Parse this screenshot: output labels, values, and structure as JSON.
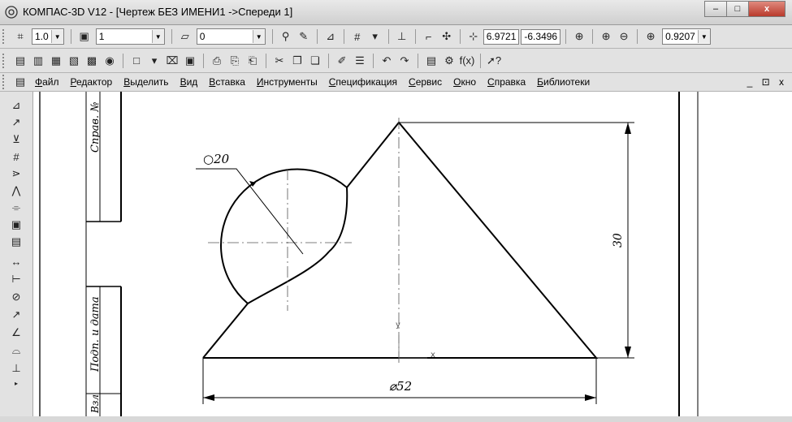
{
  "window": {
    "title": "КОМПАС-3D V12 - [Чертеж БЕЗ ИМЕНИ1 ->Спереди 1]",
    "minimize_glyph": "–",
    "maximize_glyph": "□",
    "close_glyph": "x"
  },
  "toolbar1": {
    "step_value": "1.0",
    "layer_value": "1",
    "style_value": "0",
    "coord_x": "6.9721",
    "coord_y": "-6.3496",
    "zoom_value": "0.9207"
  },
  "toolbar2": {
    "fx_label": "f(x)",
    "help_label": "?"
  },
  "menu": {
    "items": [
      "Файл",
      "Редактор",
      "Выделить",
      "Вид",
      "Вставка",
      "Инструменты",
      "Спецификация",
      "Сервис",
      "Окно",
      "Справка",
      "Библиотеки"
    ],
    "mdi_controls": "_ ⊡ x"
  },
  "drawing": {
    "stamp_top": "Справ. №",
    "stamp_bottom": "Подп. и дата",
    "stamp_cut": "Взл",
    "dim_radius": "○20",
    "dim_height": "30",
    "dim_diameter": "⌀52",
    "axis_y": "y",
    "axis_x": "x"
  }
}
